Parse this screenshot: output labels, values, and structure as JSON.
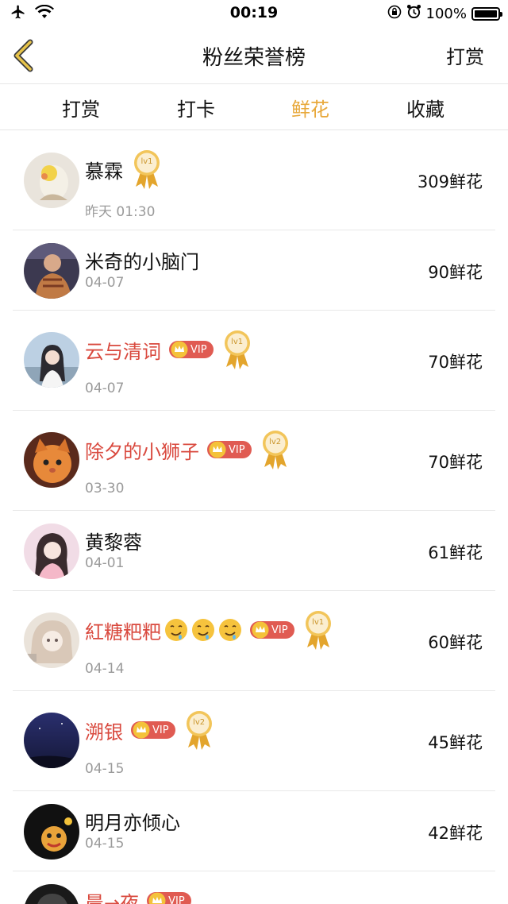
{
  "status": {
    "time": "00:19",
    "battery": "100%",
    "icons": [
      "airplane-icon",
      "wifi-icon",
      "orientation-lock-icon",
      "alarm-icon",
      "battery-icon"
    ]
  },
  "nav": {
    "back_icon": "chevron-left-icon",
    "title": "粉丝荣誉榜",
    "action": "打赏"
  },
  "tabs": [
    {
      "label": "打赏",
      "active": false
    },
    {
      "label": "打卡",
      "active": false
    },
    {
      "label": "鲜花",
      "active": true
    },
    {
      "label": "收藏",
      "active": false
    }
  ],
  "colors": {
    "accent": "#e8a83a",
    "vip_name": "#d9493e",
    "vip_badge": "#e05b52",
    "subtext": "#9a9a9a"
  },
  "badges": {
    "vip": "VIP"
  },
  "rows": [
    {
      "name": "慕霖",
      "time": "昨天 01:30",
      "value": "309鲜花",
      "vip": false,
      "lv": "lv1",
      "emojis": 0
    },
    {
      "name": "米奇的小脑门",
      "time": "04-07",
      "value": "90鲜花",
      "vip": false,
      "lv": null,
      "emojis": 0
    },
    {
      "name": "云与清词",
      "time": "04-07",
      "value": "70鲜花",
      "vip": true,
      "lv": "lv1",
      "emojis": 0
    },
    {
      "name": "除夕的小狮子",
      "time": "03-30",
      "value": "70鲜花",
      "vip": true,
      "lv": "lv2",
      "emojis": 0
    },
    {
      "name": "黄黎蓉",
      "time": "04-01",
      "value": "61鲜花",
      "vip": false,
      "lv": null,
      "emojis": 0
    },
    {
      "name": "紅糖粑粑",
      "time": "04-14",
      "value": "60鲜花",
      "vip": true,
      "lv": "lv1",
      "emojis": 3
    },
    {
      "name": "溯银",
      "time": "04-15",
      "value": "45鲜花",
      "vip": true,
      "lv": "lv2",
      "emojis": 0
    },
    {
      "name": "明月亦倾心",
      "time": "04-15",
      "value": "42鲜花",
      "vip": false,
      "lv": null,
      "emojis": 0
    },
    {
      "name": "晨→夜",
      "time": "",
      "value": "",
      "vip": true,
      "lv": null,
      "emojis": 0
    }
  ]
}
